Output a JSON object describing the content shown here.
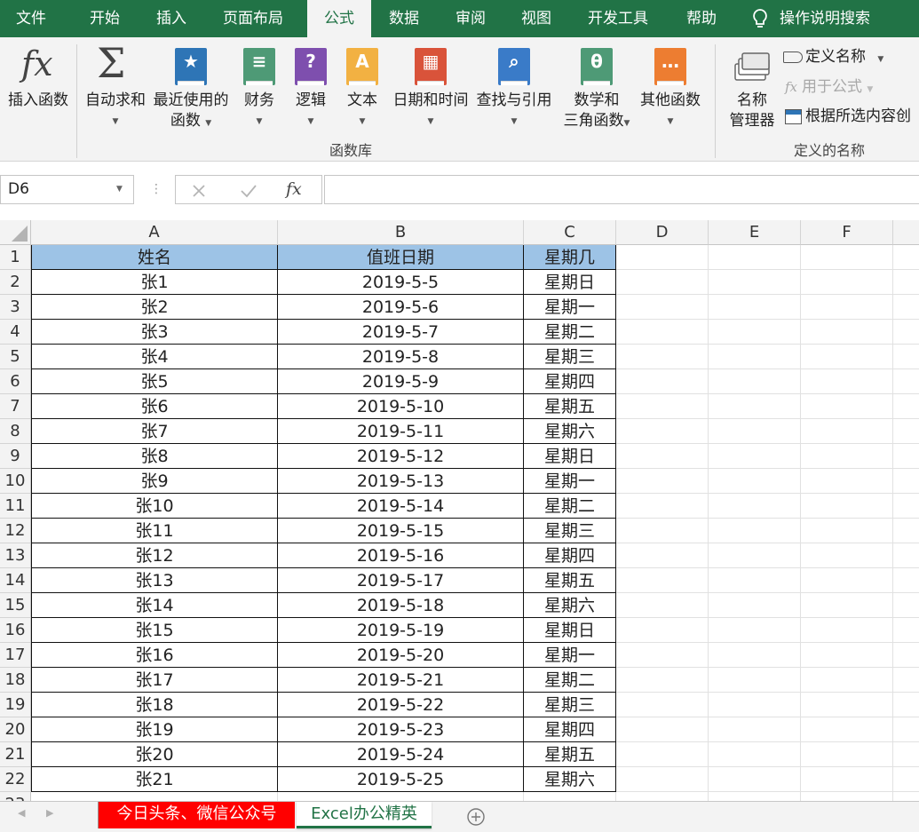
{
  "menu": {
    "tabs": [
      "文件",
      "开始",
      "插入",
      "页面布局",
      "公式",
      "数据",
      "审阅",
      "视图",
      "开发工具",
      "帮助"
    ],
    "active_tab": "公式",
    "tell_me": "操作说明搜索"
  },
  "ribbon": {
    "insert_function": "插入函数",
    "autosum": "自动求和",
    "recent_line1": "最近使用的",
    "recent_line2": "函数",
    "financial": "财务",
    "logical": "逻辑",
    "text": "文本",
    "datetime": "日期和时间",
    "lookup": "查找与引用",
    "math_line1": "数学和",
    "math_line2": "三角函数",
    "more": "其他函数",
    "group_function_library": "函数库",
    "name_mgr_line1": "名称",
    "name_mgr_line2": "管理器",
    "define_name": "定义名称",
    "use_in_formula": "用于公式",
    "create_from_selection": "根据所选内容创",
    "group_defined_names": "定义的名称",
    "icon_colors": {
      "favorites": "#2e75b6",
      "financial": "#4e9a76",
      "logical": "#7e4fae",
      "text": "#f2b142",
      "datetime": "#d9533a",
      "lookup": "#3a7bc8",
      "math": "#4e9a76",
      "more": "#ed7d31"
    }
  },
  "formula_bar": {
    "name_box": "D6",
    "formula": ""
  },
  "grid": {
    "columns": [
      "A",
      "B",
      "C",
      "D",
      "E",
      "F"
    ],
    "header_fill": "#9dc3e6",
    "headers": [
      "姓名",
      "值班日期",
      "星期几"
    ],
    "rows": [
      [
        "张1",
        "2019-5-5",
        "星期日"
      ],
      [
        "张2",
        "2019-5-6",
        "星期一"
      ],
      [
        "张3",
        "2019-5-7",
        "星期二"
      ],
      [
        "张4",
        "2019-5-8",
        "星期三"
      ],
      [
        "张5",
        "2019-5-9",
        "星期四"
      ],
      [
        "张6",
        "2019-5-10",
        "星期五"
      ],
      [
        "张7",
        "2019-5-11",
        "星期六"
      ],
      [
        "张8",
        "2019-5-12",
        "星期日"
      ],
      [
        "张9",
        "2019-5-13",
        "星期一"
      ],
      [
        "张10",
        "2019-5-14",
        "星期二"
      ],
      [
        "张11",
        "2019-5-15",
        "星期三"
      ],
      [
        "张12",
        "2019-5-16",
        "星期四"
      ],
      [
        "张13",
        "2019-5-17",
        "星期五"
      ],
      [
        "张14",
        "2019-5-18",
        "星期六"
      ],
      [
        "张15",
        "2019-5-19",
        "星期日"
      ],
      [
        "张16",
        "2019-5-20",
        "星期一"
      ],
      [
        "张17",
        "2019-5-21",
        "星期二"
      ],
      [
        "张18",
        "2019-5-22",
        "星期三"
      ],
      [
        "张19",
        "2019-5-23",
        "星期四"
      ],
      [
        "张20",
        "2019-5-24",
        "星期五"
      ],
      [
        "张21",
        "2019-5-25",
        "星期六"
      ]
    ]
  },
  "sheets": [
    {
      "name": "今日头条、微信公众号",
      "bg": "#ff0000",
      "color": "#ffffff"
    },
    {
      "name": "Excel办公精英",
      "bg": "#ffffff",
      "color": "#217346"
    }
  ]
}
